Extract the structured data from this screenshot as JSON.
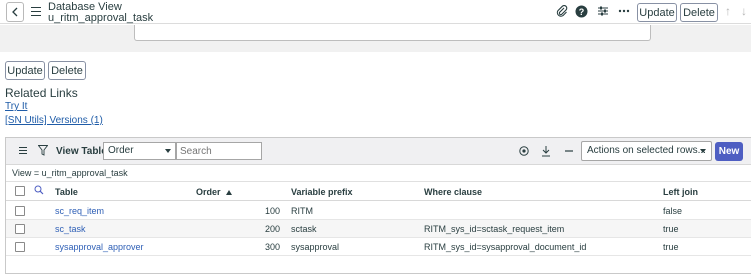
{
  "header": {
    "title_line1": "Database View",
    "title_line2": "u_ritm_approval_task",
    "update_label": "Update",
    "delete_label": "Delete"
  },
  "form": {
    "update_label": "Update",
    "delete_label": "Delete"
  },
  "related_links": {
    "title": "Related Links",
    "links": [
      "Try It",
      "[SN Utils] Versions (1)"
    ]
  },
  "list": {
    "view_tables_label": "View Tables",
    "search_field": "Order",
    "search_placeholder": "Search",
    "actions_label": "Actions on selected rows...",
    "new_label": "New",
    "breadcrumb": "View = u_ritm_approval_task",
    "columns": [
      "Table",
      "Order",
      "Variable prefix",
      "Where clause",
      "Left join"
    ],
    "rows": [
      {
        "table": "sc_req_item",
        "order": "100",
        "prefix": "RITM",
        "where": "",
        "left_join": "false"
      },
      {
        "table": "sc_task",
        "order": "200",
        "prefix": "sctask",
        "where": "RITM_sys_id=sctask_request_item",
        "left_join": "true"
      },
      {
        "table": "sysapproval_approver",
        "order": "300",
        "prefix": "sysapproval",
        "where": "RITM_sys_id=sysapproval_document_id",
        "left_join": "true"
      }
    ]
  },
  "colors": {
    "accent": "#4e5ec2",
    "link": "#1f5ca8"
  }
}
